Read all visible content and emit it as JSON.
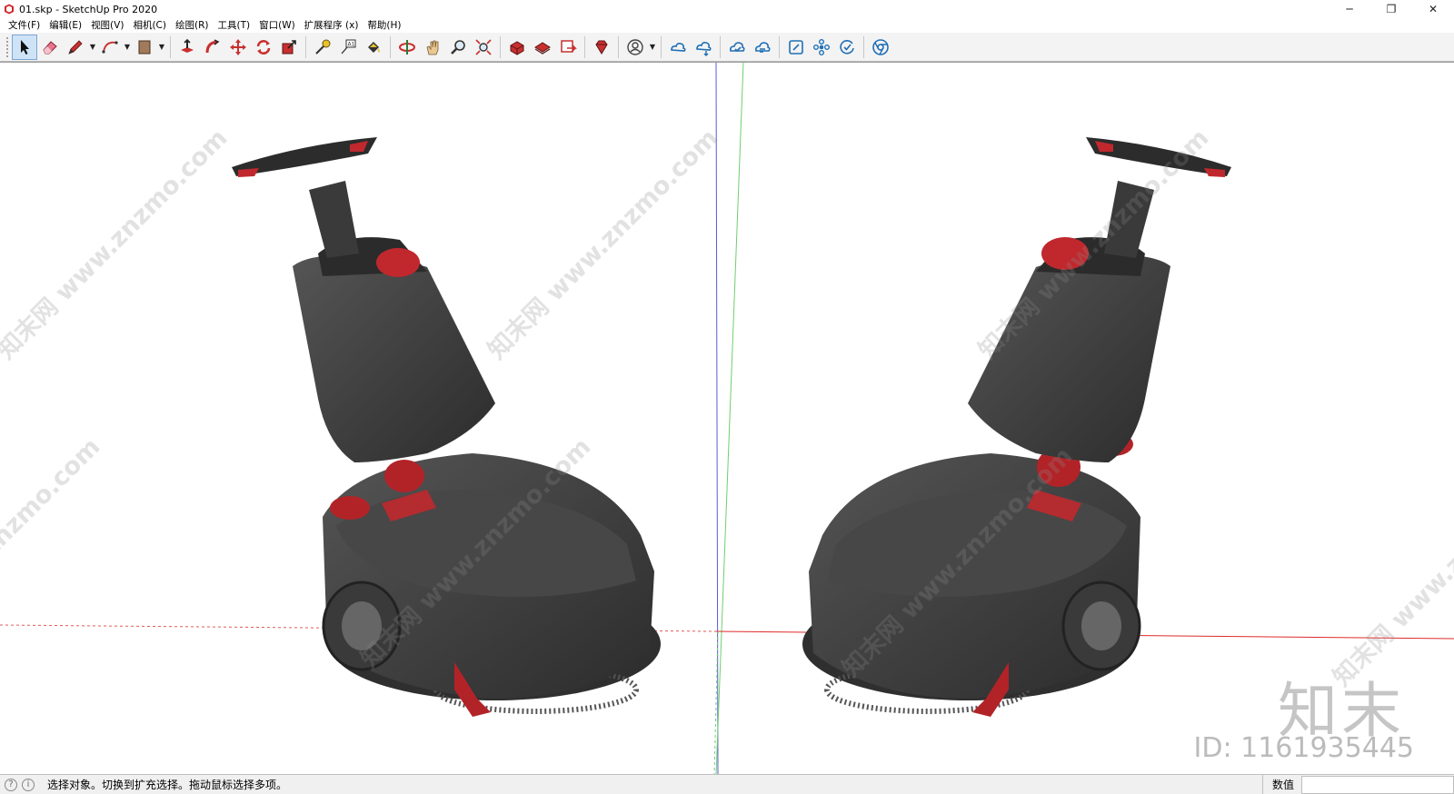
{
  "window": {
    "title": "01.skp - SketchUp Pro 2020",
    "controls": [
      "─",
      "❐",
      "✕"
    ]
  },
  "menu": [
    "文件(F)",
    "编辑(E)",
    "视图(V)",
    "相机(C)",
    "绘图(R)",
    "工具(T)",
    "窗口(W)",
    "扩展程序 (x)",
    "帮助(H)"
  ],
  "toolbar": {
    "groups": [
      [
        "select-icon",
        "eraser-icon",
        "pencil-icon",
        "arc-icon",
        "rectangle-icon"
      ],
      [
        "push-pull-icon",
        "follow-me-icon",
        "move-icon",
        "rotate-icon",
        "scale-icon"
      ],
      [
        "tape-measure-icon",
        "text-label-icon",
        "paint-bucket-icon"
      ],
      [
        "orbit-icon",
        "pan-icon",
        "zoom-icon",
        "zoom-extents-icon"
      ],
      [
        "3d-warehouse-icon",
        "extension-warehouse-icon",
        "send-to-layout-icon"
      ],
      [
        "extension-manager-icon"
      ],
      [
        "user-account-icon"
      ],
      [
        "trimble-connect-icon",
        "trimble-connect-share-icon"
      ],
      [
        "cloud-upload-icon",
        "cloud-sync-icon"
      ],
      [
        "section-plane-icon",
        "components-icon",
        "check-icon"
      ],
      [
        "chrome-icon"
      ]
    ]
  },
  "viewport": {
    "background": "#ffffff",
    "watermark": "知末网 www.znzmo.com",
    "brand_logo": "知末",
    "brand_id": "ID: 1161935445",
    "model_color": "#3b3b3b",
    "accent_color": "#c0282d"
  },
  "status": {
    "text": "选择对象。切换到扩充选择。拖动鼠标选择多项。",
    "measure_label": "数值",
    "measure_value": ""
  }
}
